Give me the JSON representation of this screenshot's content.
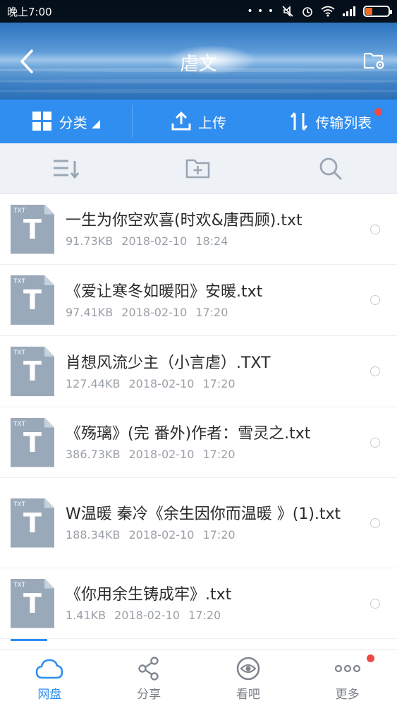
{
  "status_bar": {
    "time": "晚上7:00",
    "battery_color": "#f36b23"
  },
  "header": {
    "title": "虐文",
    "back_icon": "chevron-left-icon",
    "folder_settings_icon": "folder-settings-icon"
  },
  "actions": [
    {
      "label": "分类",
      "icon": "grid-icon"
    },
    {
      "label": "上传",
      "icon": "upload-icon"
    },
    {
      "label": "传输列表",
      "icon": "transfer-icon"
    }
  ],
  "toolbar": {
    "sort_icon": "sort-icon",
    "new_folder_icon": "new-folder-icon",
    "search_icon": "search-icon"
  },
  "files": [
    {
      "type": "TXT",
      "name": "一生为你空欢喜(时欢&唐西顾).txt",
      "size": "91.73KB",
      "date": "2018-02-10",
      "time": "18:24"
    },
    {
      "type": "TXT",
      "name": "《爱让寒冬如暖阳》安暖.txt",
      "size": "97.41KB",
      "date": "2018-02-10",
      "time": "17:20"
    },
    {
      "type": "TXT",
      "name": "肖想风流少主（小言虐）.TXT",
      "size": "127.44KB",
      "date": "2018-02-10",
      "time": "17:20"
    },
    {
      "type": "TXT",
      "name": "《殇璃》(完 番外)作者：雪灵之.txt",
      "size": "386.73KB",
      "date": "2018-02-10",
      "time": "17:20"
    },
    {
      "type": "TXT",
      "name": "W温暖 秦冷《余生因你而温暖 》(1).txt",
      "size": "188.34KB",
      "date": "2018-02-10",
      "time": "17:20"
    },
    {
      "type": "TXT",
      "name": "《你用余生铸成牢》.txt",
      "size": "1.41KB",
      "date": "2018-02-10",
      "time": "17:20"
    }
  ],
  "bottom_nav": [
    {
      "label": "网盘",
      "icon": "cloud-icon",
      "active": true
    },
    {
      "label": "分享",
      "icon": "share-icon",
      "active": false
    },
    {
      "label": "看吧",
      "icon": "eye-icon",
      "active": false
    },
    {
      "label": "更多",
      "icon": "more-icon",
      "active": false
    }
  ],
  "colors": {
    "accent": "#2f8ef0",
    "badge": "#ef4a45"
  }
}
